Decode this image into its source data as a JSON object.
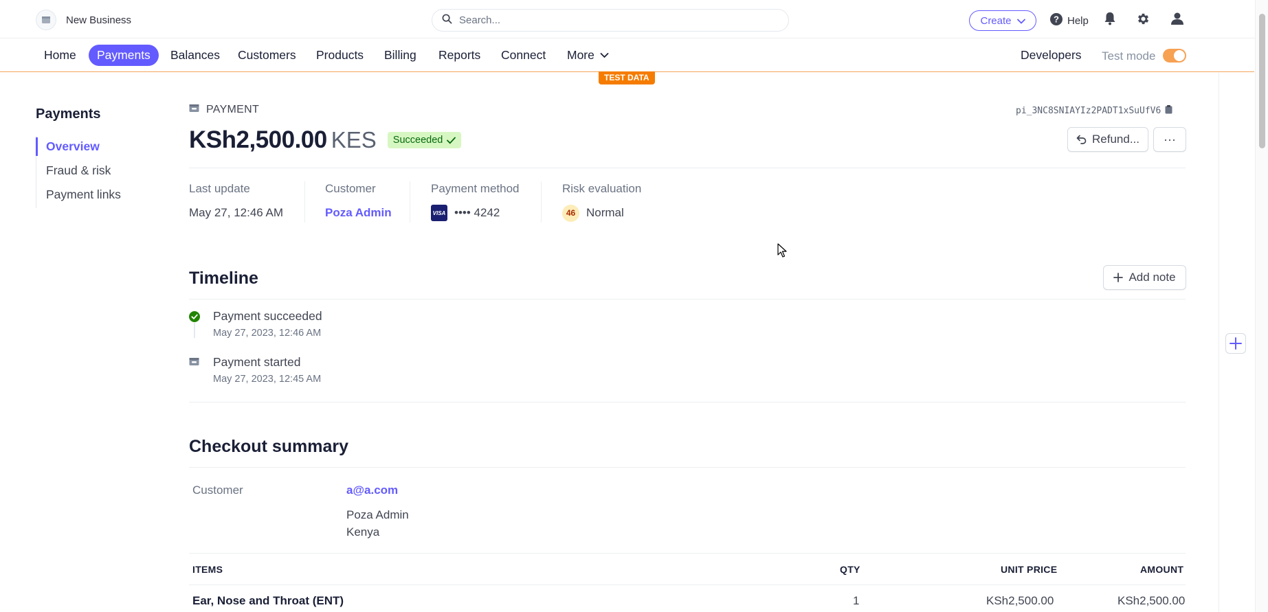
{
  "header": {
    "business_name": "New Business",
    "search_placeholder": "Search...",
    "create_label": "Create",
    "help_label": "Help"
  },
  "nav": {
    "items": [
      {
        "label": "Home",
        "active": false
      },
      {
        "label": "Payments",
        "active": true
      },
      {
        "label": "Balances",
        "active": false
      },
      {
        "label": "Customers",
        "active": false
      },
      {
        "label": "Products",
        "active": false
      },
      {
        "label": "Billing",
        "active": false
      },
      {
        "label": "Reports",
        "active": false
      },
      {
        "label": "Connect",
        "active": false
      },
      {
        "label": "More",
        "active": false
      }
    ],
    "developers_label": "Developers",
    "test_mode_label": "Test mode",
    "test_mode_on": true
  },
  "test_data_badge": "TEST DATA",
  "sidebar": {
    "title": "Payments",
    "items": [
      {
        "label": "Overview",
        "active": true
      },
      {
        "label": "Fraud & risk",
        "active": false
      },
      {
        "label": "Payment links",
        "active": false
      }
    ]
  },
  "payment": {
    "type_label": "PAYMENT",
    "id": "pi_3NC8SNIAYIz2PADT1xSuUfV6",
    "amount": "KSh2,500.00",
    "currency": "KES",
    "status": "Succeeded",
    "refund_label": "Refund...",
    "more_label": "···"
  },
  "meta": {
    "last_update_label": "Last update",
    "last_update_value": "May 27, 12:46 AM",
    "customer_label": "Customer",
    "customer_value": "Poza Admin",
    "payment_method_label": "Payment method",
    "card_brand": "VISA",
    "card_last4": "•••• 4242",
    "risk_label": "Risk evaluation",
    "risk_score": "46",
    "risk_level": "Normal"
  },
  "timeline": {
    "title": "Timeline",
    "add_note_label": "Add note",
    "events": [
      {
        "title": "Payment succeeded",
        "time": "May 27, 2023, 12:46 AM"
      },
      {
        "title": "Payment started",
        "time": "May 27, 2023, 12:45 AM"
      }
    ]
  },
  "checkout": {
    "title": "Checkout summary",
    "customer_label": "Customer",
    "customer_email": "a@a.com",
    "customer_name": "Poza Admin",
    "customer_country": "Kenya",
    "columns": {
      "items": "ITEMS",
      "qty": "QTY",
      "unit_price": "UNIT PRICE",
      "amount": "AMOUNT"
    },
    "rows": [
      {
        "item": "Ear, Nose and Throat (ENT)",
        "qty": "1",
        "unit_price": "KSh2,500.00",
        "amount": "KSh2,500.00"
      }
    ]
  },
  "colors": {
    "accent": "#635bff",
    "test_orange": "#f57c00",
    "success_bg": "#d7f7c2",
    "success_text": "#05690d"
  }
}
